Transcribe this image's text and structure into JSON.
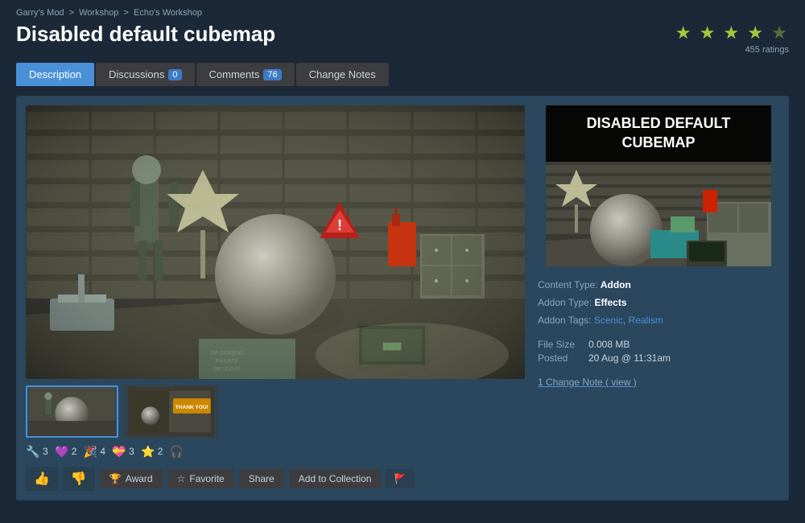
{
  "breadcrumb": {
    "items": [
      {
        "label": "Garry's Mod",
        "href": "#"
      },
      {
        "label": "Workshop",
        "href": "#"
      },
      {
        "label": "Echo's Workshop",
        "href": "#"
      }
    ],
    "separator": ">"
  },
  "title": "Disabled default cubemap",
  "rating": {
    "stars": 4.5,
    "count": "455 ratings",
    "filled": 4,
    "half": true
  },
  "tabs": [
    {
      "label": "Description",
      "badge": null,
      "active": true
    },
    {
      "label": "Discussions",
      "badge": "0",
      "active": false
    },
    {
      "label": "Comments",
      "badge": "76",
      "active": false
    },
    {
      "label": "Change Notes",
      "badge": null,
      "active": false
    }
  ],
  "addon_info": {
    "preview_title": "DISABLED DEFAULT CUBEMAP",
    "content_type_label": "Content Type:",
    "content_type_value": "Addon",
    "addon_type_label": "Addon Type:",
    "addon_type_value": "Effects",
    "addon_tags_label": "Addon Tags:",
    "addon_tags": [
      "Scenic",
      "Realism"
    ],
    "file_size_label": "File Size",
    "file_size_value": "0.008 MB",
    "posted_label": "Posted",
    "posted_value": "20 Aug @ 11:31am",
    "change_note_text": "1 Change Note",
    "change_note_link": "( view )"
  },
  "reactions": [
    {
      "icon": "🔧",
      "count": "3"
    },
    {
      "icon": "💜",
      "count": "2"
    },
    {
      "icon": "🎉",
      "count": "4"
    },
    {
      "icon": "💝",
      "count": "3"
    },
    {
      "icon": "⭐",
      "count": "2"
    },
    {
      "icon": "🎧",
      "count": ""
    }
  ],
  "actions": [
    {
      "label": "👍",
      "name": "thumbup-button",
      "type": "thumb"
    },
    {
      "label": "👎",
      "name": "thumbdown-button",
      "type": "thumb"
    },
    {
      "label": "🏆 Award",
      "name": "award-button",
      "type": "normal"
    },
    {
      "label": "☆ Favorite",
      "name": "favorite-button",
      "type": "normal"
    },
    {
      "label": "Share",
      "name": "share-button",
      "type": "normal"
    },
    {
      "label": "Add to Collection",
      "name": "addtocollection-button",
      "type": "normal"
    },
    {
      "label": "🚩",
      "name": "flag-button",
      "type": "flag"
    }
  ]
}
